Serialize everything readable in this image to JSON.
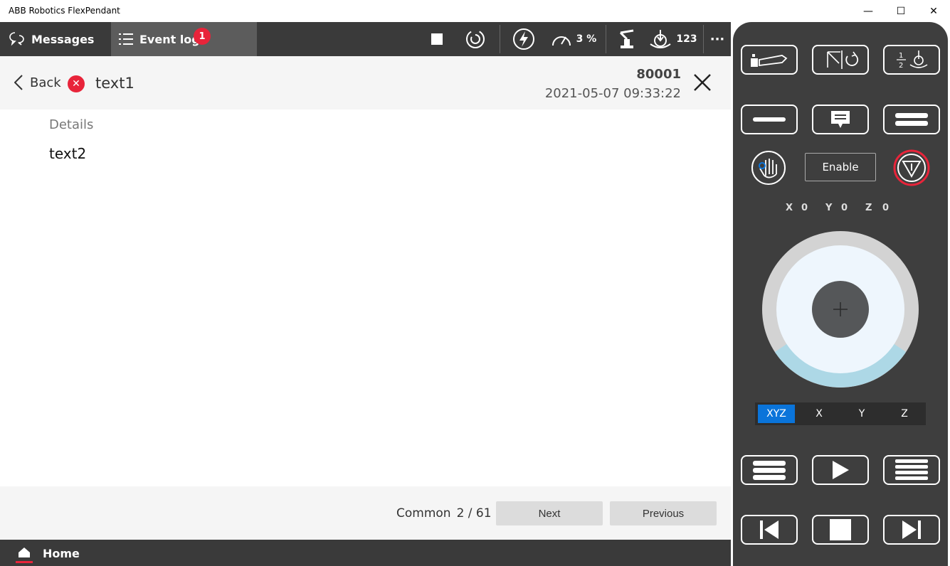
{
  "window": {
    "title": "ABB Robotics FlexPendant",
    "minimize": "—",
    "maximize": "☐",
    "close": "✕"
  },
  "topbar": {
    "tabs": [
      {
        "label": "Messages",
        "icon": "chat-bubbles-icon",
        "active": false
      },
      {
        "label": "Event log",
        "icon": "list-icon",
        "active": true,
        "badge": "1"
      }
    ],
    "speed_value": "3 %",
    "tool_count": "123",
    "more": "···"
  },
  "event": {
    "back_label": "Back",
    "title": "text1",
    "code": "80001",
    "timestamp": "2021-05-07 09:33:22",
    "details_label": "Details",
    "details_text": "text2"
  },
  "footer": {
    "category": "Common",
    "page": "2 / 61",
    "next_label": "Next",
    "previous_label": "Previous"
  },
  "bottombar": {
    "home_label": "Home"
  },
  "jog_panel": {
    "enable_label": "Enable",
    "coords": [
      {
        "axis": "X",
        "value": "0"
      },
      {
        "axis": "Y",
        "value": "0"
      },
      {
        "axis": "Z",
        "value": "0"
      }
    ],
    "axis_options": [
      "XYZ",
      "X",
      "Y",
      "Z"
    ],
    "selected_axis": "XYZ"
  },
  "colors": {
    "dark_bar": "#3a3a3a",
    "active_tab": "#5c5c5c",
    "error_red": "#e8243a",
    "accent_blue": "#0a74da",
    "joystick_light_blue": "#add8e6"
  }
}
